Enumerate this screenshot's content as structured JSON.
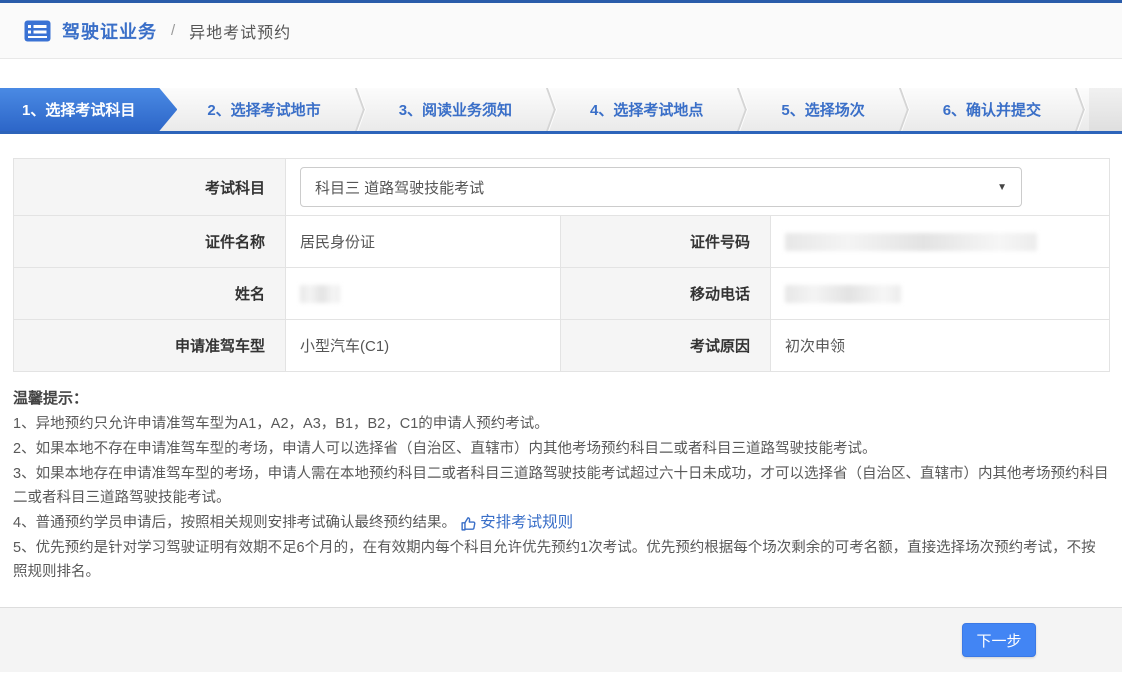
{
  "colors": {
    "accent_blue": "#3a6fc8",
    "top_line": "#2a5caa",
    "active_tab_top": "#4a8ae4",
    "active_tab_bottom": "#2d66c8",
    "tab_bar_border": "#2d64ba",
    "button_blue": "#4285f4",
    "label_cell_bg": "#f5f5f5"
  },
  "breadcrumb": {
    "icon": "list-card-icon",
    "section": "驾驶证业务",
    "separator": "/",
    "current": "异地考试预约"
  },
  "steps": [
    {
      "label": "1、选择考试科目",
      "active": true
    },
    {
      "label": "2、选择考试地市",
      "active": false
    },
    {
      "label": "3、阅读业务须知",
      "active": false
    },
    {
      "label": "4、选择考试地点",
      "active": false
    },
    {
      "label": "5、选择场次",
      "active": false
    },
    {
      "label": "6、确认并提交",
      "active": false
    }
  ],
  "form": {
    "subject_label": "考试科目",
    "subject_value": "科目三 道路驾驶技能考试",
    "cert_name_label": "证件名称",
    "cert_name_value": "居民身份证",
    "cert_no_label": "证件号码",
    "name_label": "姓名",
    "phone_label": "移动电话",
    "vehicle_label": "申请准驾车型",
    "vehicle_value": "小型汽车(C1)",
    "reason_label": "考试原因",
    "reason_value": "初次申领"
  },
  "tips": {
    "title": "温馨提示：",
    "line1": "1、异地预约只允许申请准驾车型为A1，A2，A3，B1，B2，C1的申请人预约考试。",
    "line2": "2、如果本地不存在申请准驾车型的考场，申请人可以选择省（自治区、直辖市）内其他考场预约科目二或者科目三道路驾驶技能考试。",
    "line3": "3、如果本地存在申请准驾车型的考场，申请人需在本地预约科目二或者科目三道路驾驶技能考试超过六十日未成功，才可以选择省（自治区、直辖市）内其他考场预约科目二或者科目三道路驾驶技能考试。",
    "line4": "4、普通预约学员申请后，按照相关规则安排考试确认最终预约结果。",
    "link_label": "安排考试规则",
    "line5": "5、优先预约是针对学习驾驶证明有效期不足6个月的，在有效期内每个科目允许优先预约1次考试。优先预约根据每个场次剩余的可考名额，直接选择场次预约考试，不按照规则排名。"
  },
  "footer": {
    "next_button": "下一步"
  }
}
